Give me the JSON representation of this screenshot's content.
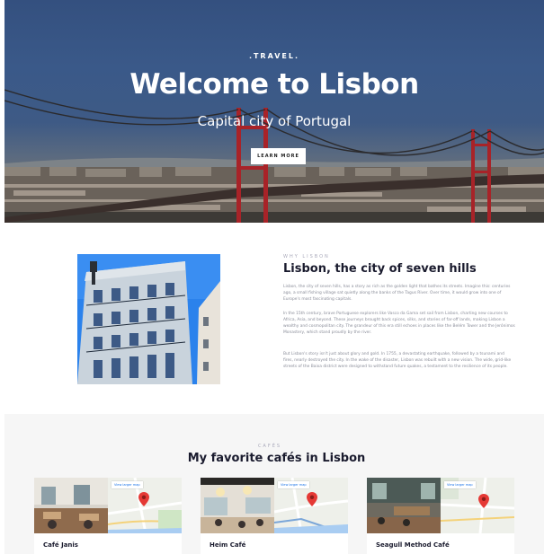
{
  "hero": {
    "eyebrow": ".TRAVEL.",
    "title": "Welcome to Lisbon",
    "tagline": "Capital city of Portugal",
    "button_label": "LEARN MORE"
  },
  "about": {
    "eyebrow": "WHY LISBON",
    "title": "Lisbon, the city of seven hills",
    "paragraphs": [
      "Lisbon, the city of seven hills, has a story as rich as the golden light that bathes its streets. Imagine this: centuries ago, a small fishing village sat quietly along the banks of the Tagus River. Over time, it would grow into one of Europe's most fascinating capitals.",
      "In the 15th century, brave Portuguese explorers like Vasco da Gama set sail from Lisbon, charting new courses to Africa, Asia, and beyond. These journeys brought back spices, silks, and stories of far-off lands, making Lisbon a wealthy and cosmopolitan city. The grandeur of this era still echoes in places like the Belém Tower and the Jerónimos Monastery, which stand proudly by the river.",
      "But Lisbon's story isn't just about glory and gold. In 1755, a devastating earthquake, followed by a tsunami and fires, nearly destroyed the city. In the wake of the disaster, Lisbon was rebuilt with a new vision. The wide, grid-like streets of the Baixa district were designed to withstand future quakes, a testament to the resilience of its people."
    ]
  },
  "cafes": {
    "eyebrow": "CAFÉS",
    "title": "My favorite cafés in Lisbon",
    "map_link": "View larger map",
    "items": [
      {
        "name": "Café Janis",
        "pin_label": "Café Janis"
      },
      {
        "name": "Heim Café",
        "pin_label": "Heim Café"
      },
      {
        "name": "Seagull Method Café",
        "pin_label": "Seagull Method"
      }
    ]
  },
  "colors": {
    "hero_sky": "#3a5989",
    "bridge_red": "#b0252a",
    "title_text": "#1a1b2e",
    "body_text": "#8a8d99",
    "section_bg": "#f6f6f6",
    "map_link": "#1a73e8",
    "map_pin": "#e53935"
  }
}
